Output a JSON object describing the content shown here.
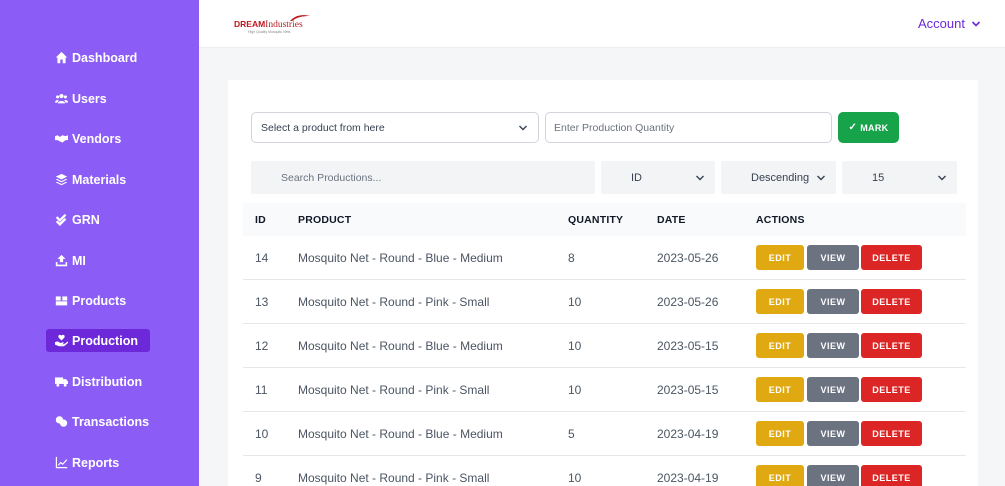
{
  "sidebar": {
    "items": [
      {
        "label": "Dashboard",
        "icon": "home-icon"
      },
      {
        "label": "Users",
        "icon": "users-icon"
      },
      {
        "label": "Vendors",
        "icon": "handshake-icon"
      },
      {
        "label": "Materials",
        "icon": "layers-icon"
      },
      {
        "label": "GRN",
        "icon": "double-check-icon"
      },
      {
        "label": "MI",
        "icon": "upload-icon"
      },
      {
        "label": "Products",
        "icon": "boxes-icon"
      },
      {
        "label": "Production",
        "icon": "hand-holding-icon"
      },
      {
        "label": "Distribution",
        "icon": "truck-icon"
      },
      {
        "label": "Transactions",
        "icon": "exchange-icon"
      },
      {
        "label": "Reports",
        "icon": "chart-line-icon"
      }
    ],
    "active": "Production"
  },
  "header": {
    "logo_part1": "DREAM",
    "logo_part2": "Industries",
    "logo_tagline": "High Quality Mosquito Nets",
    "account_label": "Account"
  },
  "form": {
    "product_select": "Select a product from here",
    "quantity_placeholder": "Enter Production Quantity",
    "mark_label": "MARK"
  },
  "filters": {
    "search_placeholder": "Search Productions...",
    "sort_field": "ID",
    "sort_order": "Descending",
    "page_size": "15"
  },
  "table": {
    "headers": {
      "id": "ID",
      "product": "PRODUCT",
      "quantity": "QUANTITY",
      "date": "DATE",
      "actions": "ACTIONS"
    },
    "actions": {
      "edit": "EDIT",
      "view": "VIEW",
      "delete": "DELETE"
    },
    "rows": [
      {
        "id": "14",
        "product": "Mosquito Net - Round - Blue - Medium",
        "quantity": "8",
        "date": "2023-05-26"
      },
      {
        "id": "13",
        "product": "Mosquito Net - Round - Pink - Small",
        "quantity": "10",
        "date": "2023-05-26"
      },
      {
        "id": "12",
        "product": "Mosquito Net - Round - Blue - Medium",
        "quantity": "10",
        "date": "2023-05-15"
      },
      {
        "id": "11",
        "product": "Mosquito Net - Round - Pink - Small",
        "quantity": "10",
        "date": "2023-05-15"
      },
      {
        "id": "10",
        "product": "Mosquito Net - Round - Blue - Medium",
        "quantity": "5",
        "date": "2023-04-19"
      },
      {
        "id": "9",
        "product": "Mosquito Net - Round - Pink - Small",
        "quantity": "10",
        "date": "2023-04-19"
      }
    ]
  },
  "colors": {
    "sidebar_bg": "#8b5cf6",
    "sidebar_active": "#6d28d9",
    "mark_green": "#16a34a",
    "edit_amber": "#e0a811",
    "view_gray": "#6b7280",
    "delete_red": "#dc2626"
  }
}
